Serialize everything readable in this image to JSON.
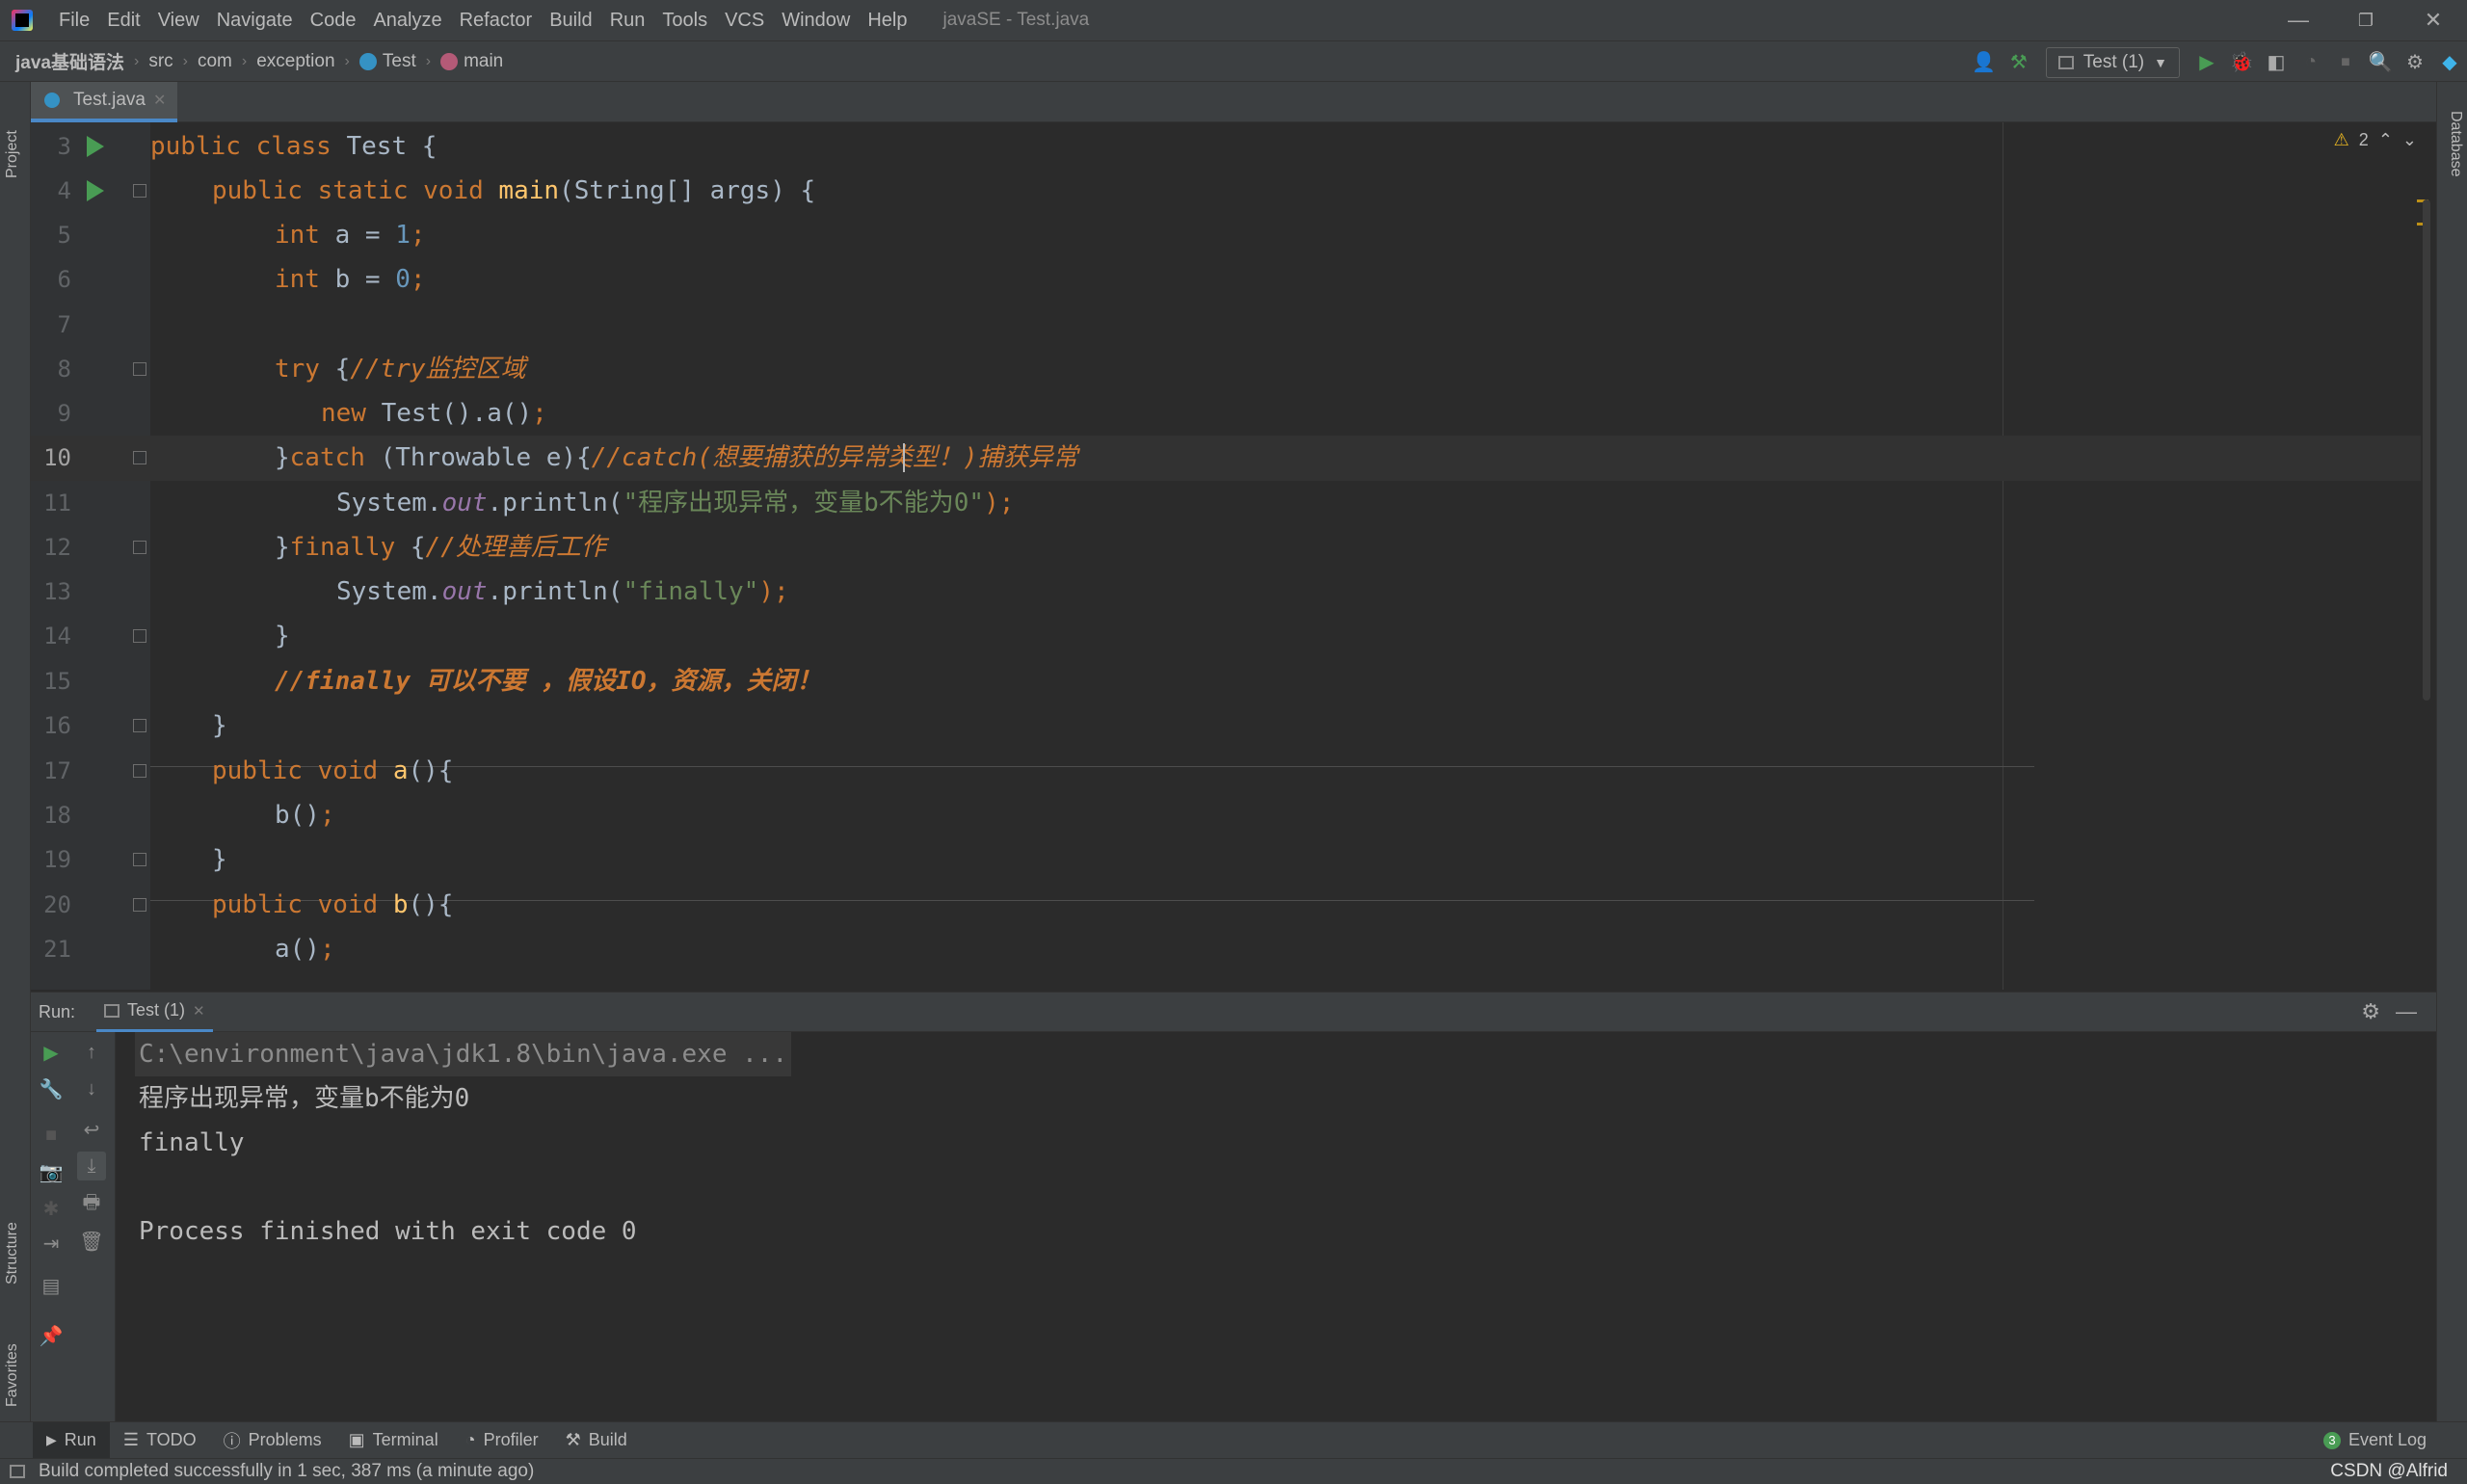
{
  "titlebar": {
    "menu": [
      "File",
      "Edit",
      "View",
      "Navigate",
      "Code",
      "Analyze",
      "Refactor",
      "Build",
      "Run",
      "Tools",
      "VCS",
      "Window",
      "Help"
    ],
    "window_title": "javaSE - Test.java"
  },
  "breadcrumb": [
    "java基础语法",
    "src",
    "com",
    "exception",
    "Test",
    "main"
  ],
  "toolbar": {
    "run_config": "Test (1)"
  },
  "left_tools": {
    "project": "Project",
    "structure": "Structure",
    "favorites": "Favorites"
  },
  "right_tools": {
    "database": "Database"
  },
  "editor_tab": {
    "label": "Test.java"
  },
  "inspection": {
    "warnings": "2"
  },
  "code_lines": [
    {
      "n": "3"
    },
    {
      "n": "4"
    },
    {
      "n": "5"
    },
    {
      "n": "6"
    },
    {
      "n": "7"
    },
    {
      "n": "8"
    },
    {
      "n": "9"
    },
    {
      "n": "10"
    },
    {
      "n": "11"
    },
    {
      "n": "12"
    },
    {
      "n": "13"
    },
    {
      "n": "14"
    },
    {
      "n": "15"
    },
    {
      "n": "16"
    },
    {
      "n": "17"
    },
    {
      "n": "18"
    },
    {
      "n": "19"
    },
    {
      "n": "20"
    },
    {
      "n": "21"
    }
  ],
  "code": {
    "l3": [
      "public class ",
      "Test {"
    ],
    "l4": [
      "public static void ",
      "main",
      "(String[] args) {"
    ],
    "l5": [
      "int ",
      "a = ",
      "1",
      ";"
    ],
    "l6": [
      "int ",
      "b = ",
      "0",
      ";"
    ],
    "l8": [
      "try ",
      "{",
      "//try监控区域"
    ],
    "l9": [
      "new ",
      "Test().a()",
      ";"
    ],
    "l10": [
      "}",
      "catch ",
      "(Throwable e){",
      "//catch(想要捕获的异常类型！)捕获异常"
    ],
    "l11": [
      "System.",
      "out",
      ".println(",
      "\"程序出现异常，变量b不能为0\"",
      ");"
    ],
    "l12": [
      "}",
      "finally ",
      "{",
      "//处理善后工作"
    ],
    "l13": [
      "System.",
      "out",
      ".println(",
      "\"finally\"",
      ");"
    ],
    "l14": [
      "}"
    ],
    "l15": [
      "//finally 可以不要 ，假设IO，资源，关闭！"
    ],
    "l16": [
      "}"
    ],
    "l17": [
      "public void ",
      "a",
      "(){"
    ],
    "l18": [
      "b()",
      ";"
    ],
    "l19": [
      "}"
    ],
    "l20": [
      "public void ",
      "b",
      "(){"
    ],
    "l21": [
      "a()",
      ";"
    ]
  },
  "run_panel": {
    "label": "Run:",
    "tab": "Test (1)",
    "output": [
      "C:\\environment\\java\\jdk1.8\\bin\\java.exe ...",
      "程序出现异常，变量b不能为0",
      "finally",
      "",
      "Process finished with exit code 0"
    ]
  },
  "bottom_tools": [
    "Run",
    "TODO",
    "Problems",
    "Terminal",
    "Profiler",
    "Build"
  ],
  "event_log": {
    "count": "3",
    "label": "Event Log"
  },
  "status": {
    "message": "Build completed successfully in 1 sec, 387 ms (a minute ago)",
    "watermark": "CSDN @Alfrid"
  },
  "colors": {
    "keyword": "#cc7832",
    "method": "#ffc66d",
    "number": "#6897bb",
    "string": "#6a8759",
    "field": "#9876aa",
    "text": "#a9b7c6",
    "run_green": "#499c54",
    "tab_accent": "#4a88c7"
  }
}
